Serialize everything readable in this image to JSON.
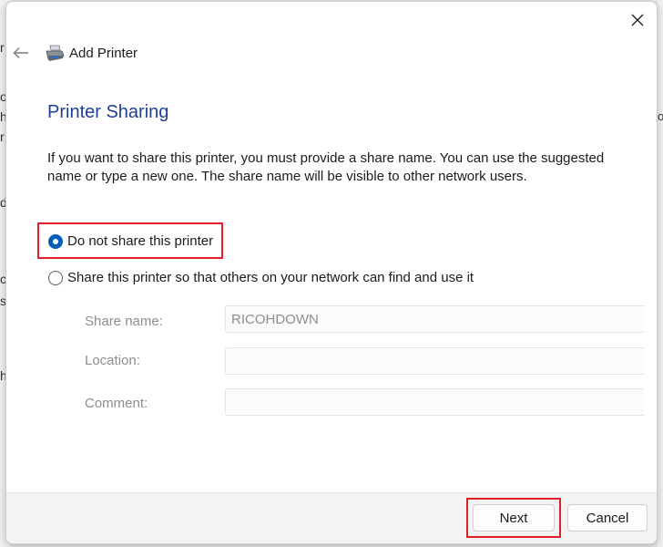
{
  "window": {
    "title": "Add Printer",
    "close_icon": "close-icon",
    "back_icon": "back-arrow-icon",
    "app_icon": "printer-icon"
  },
  "page": {
    "heading": "Printer Sharing",
    "description": "If you want to share this printer, you must provide a share name. You can use the suggested name or type a new one. The share name will be visible to other network users."
  },
  "sharing_options": [
    {
      "label": "Do not share this printer",
      "selected": true
    },
    {
      "label": "Share this printer so that others on your network can find and use it",
      "selected": false
    }
  ],
  "fields": {
    "share_name": {
      "label": "Share name:",
      "value": "RICOHDOWN"
    },
    "location": {
      "label": "Location:",
      "value": ""
    },
    "comment": {
      "label": "Comment:",
      "value": ""
    }
  },
  "footer": {
    "next_label": "Next",
    "cancel_label": "Cancel"
  },
  "colors": {
    "heading": "#1f3f95",
    "accent": "#005fb8",
    "highlight": "#e3202a"
  }
}
